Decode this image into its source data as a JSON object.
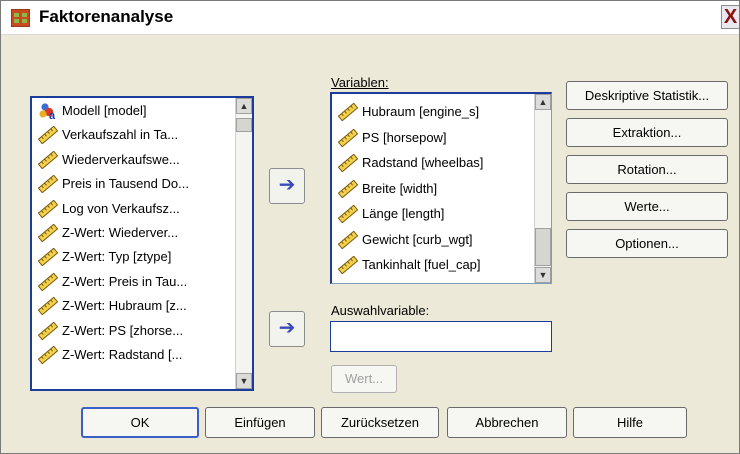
{
  "window": {
    "title": "Faktorenanalyse",
    "close_label": "X"
  },
  "source_list": {
    "items": [
      {
        "label": "Modell [model]",
        "icon": "nominal-icon"
      },
      {
        "label": "Verkaufszahl in Ta...",
        "icon": "scale-icon"
      },
      {
        "label": "Wiederverkaufswe...",
        "icon": "scale-icon"
      },
      {
        "label": "Preis in Tausend Do...",
        "icon": "scale-icon"
      },
      {
        "label": "Log von Verkaufsz...",
        "icon": "scale-icon"
      },
      {
        "label": "Z-Wert:  Wiederver...",
        "icon": "scale-icon"
      },
      {
        "label": "Z-Wert: Typ [ztype]",
        "icon": "scale-icon"
      },
      {
        "label": "Z-Wert: Preis in Tau...",
        "icon": "scale-icon"
      },
      {
        "label": "Z-Wert: Hubraum [z...",
        "icon": "scale-icon"
      },
      {
        "label": "Z-Wert: PS [zhorse...",
        "icon": "scale-icon"
      },
      {
        "label": "Z-Wert: Radstand [...",
        "icon": "scale-icon"
      }
    ]
  },
  "variables": {
    "label": "Variablen:",
    "items": [
      {
        "label": "Hubraum [engine_s]",
        "icon": "scale-icon"
      },
      {
        "label": "PS [horsepow]",
        "icon": "scale-icon"
      },
      {
        "label": "Radstand [wheelbas]",
        "icon": "scale-icon"
      },
      {
        "label": "Breite [width]",
        "icon": "scale-icon"
      },
      {
        "label": "Länge [length]",
        "icon": "scale-icon"
      },
      {
        "label": "Gewicht [curb_wgt]",
        "icon": "scale-icon"
      },
      {
        "label": "Tankinhalt [fuel_cap]",
        "icon": "scale-icon"
      }
    ]
  },
  "selection": {
    "label": "Auswahlvariable:",
    "value": "",
    "value_button": "Wert..."
  },
  "side_buttons": [
    "Deskriptive Statistik...",
    "Extraktion...",
    "Rotation...",
    "Werte...",
    "Optionen..."
  ],
  "bottom_buttons": [
    "OK",
    "Einfügen",
    "Zurücksetzen",
    "Abbrechen",
    "Hilfe"
  ],
  "colors": {
    "dialog_bg": "#ece9d8",
    "focus_border": "#1c3c9c",
    "arrow": "#3a4ab8"
  }
}
